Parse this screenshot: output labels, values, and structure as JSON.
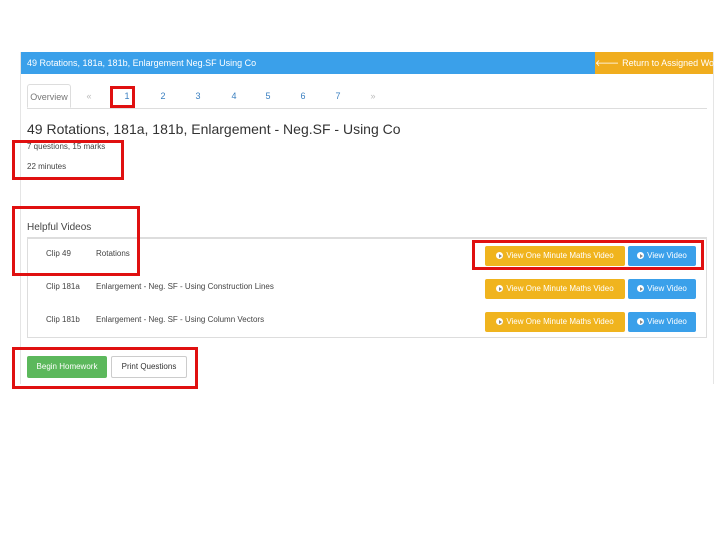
{
  "header": {
    "title": "49 Rotations, 181a, 181b, Enlargement   Neg.SF   Using Co",
    "return_label": "Return to Assigned Work",
    "return_icon": "arrow-left-icon",
    "bar_color": "#3aa0ea",
    "return_color": "#f0ad1e"
  },
  "tabs": {
    "overview": "Overview",
    "prev": "«",
    "items": [
      "1",
      "2",
      "3",
      "4",
      "5",
      "6",
      "7"
    ],
    "next": "»"
  },
  "assignment": {
    "title": "49 Rotations, 181a, 181b, Enlargement - Neg.SF - Using Co",
    "questions": "7 questions, 15 marks",
    "time": "22 minutes"
  },
  "videos": {
    "heading": "Helpful Videos",
    "rows": [
      {
        "clip": "Clip 49",
        "desc": "Rotations",
        "omm_label": "View One Minute Maths Video",
        "view_label": "View Video"
      },
      {
        "clip": "Clip 181a",
        "desc": "Enlargement - Neg. SF - Using Construction Lines",
        "omm_label": "View One Minute Maths Video",
        "view_label": "View Video"
      },
      {
        "clip": "Clip 181b",
        "desc": "Enlargement - Neg. SF - Using Column Vectors",
        "omm_label": "View One Minute Maths Video",
        "view_label": "View Video"
      }
    ]
  },
  "actions": {
    "begin_label": "Begin Homework",
    "print_label": "Print Questions",
    "begin_color": "#5cb85c"
  },
  "highlight_color": "#e01010"
}
